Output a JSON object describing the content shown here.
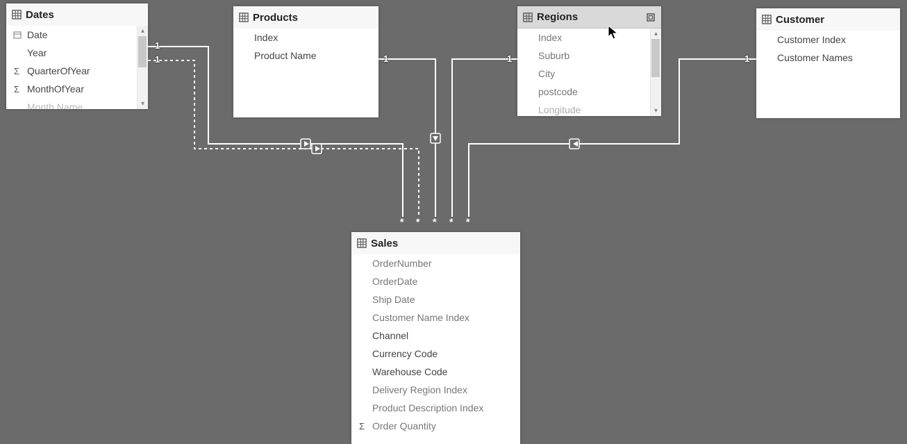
{
  "tables": {
    "dates": {
      "name": "Dates",
      "fields": [
        {
          "label": "Date",
          "sigma": false
        },
        {
          "label": "Year",
          "sigma": false
        },
        {
          "label": "QuarterOfYear",
          "sigma": true
        },
        {
          "label": "MonthOfYear",
          "sigma": true
        },
        {
          "label": "Month Name",
          "sigma": false
        }
      ]
    },
    "products": {
      "name": "Products",
      "fields": [
        {
          "label": "Index",
          "sigma": false
        },
        {
          "label": "Product Name",
          "sigma": false
        }
      ]
    },
    "regions": {
      "name": "Regions",
      "fields": [
        {
          "label": "Index",
          "sigma": false
        },
        {
          "label": "Suburb",
          "sigma": false
        },
        {
          "label": "City",
          "sigma": false
        },
        {
          "label": "postcode",
          "sigma": false
        },
        {
          "label": "Longitude",
          "sigma": false
        }
      ]
    },
    "customer": {
      "name": "Customer",
      "fields": [
        {
          "label": "Customer Index",
          "sigma": false
        },
        {
          "label": "Customer Names",
          "sigma": false
        }
      ]
    },
    "sales": {
      "name": "Sales",
      "fields": [
        {
          "label": "OrderNumber",
          "sigma": false,
          "dim": true
        },
        {
          "label": "OrderDate",
          "sigma": false,
          "dim": true
        },
        {
          "label": "Ship Date",
          "sigma": false,
          "dim": true
        },
        {
          "label": "Customer Name Index",
          "sigma": false,
          "dim": true
        },
        {
          "label": "Channel",
          "sigma": false,
          "dim": false
        },
        {
          "label": "Currency Code",
          "sigma": false,
          "dim": false
        },
        {
          "label": "Warehouse Code",
          "sigma": false,
          "dim": false
        },
        {
          "label": "Delivery Region Index",
          "sigma": false,
          "dim": true
        },
        {
          "label": "Product Description Index",
          "sigma": false,
          "dim": true
        },
        {
          "label": "Order Quantity",
          "sigma": true,
          "dim": true
        }
      ]
    }
  },
  "relationships": [
    {
      "from": "dates",
      "to": "sales",
      "from_card": "1",
      "to_card": "*",
      "active": true
    },
    {
      "from": "dates",
      "to": "sales",
      "from_card": "1",
      "to_card": "*",
      "active": false
    },
    {
      "from": "products",
      "to": "sales",
      "from_card": "1",
      "to_card": "*",
      "active": true
    },
    {
      "from": "regions",
      "to": "sales",
      "from_card": "1",
      "to_card": "*",
      "active": true
    },
    {
      "from": "customer",
      "to": "sales",
      "from_card": "1",
      "to_card": "*",
      "active": true
    }
  ],
  "labels": {
    "one": "1",
    "many": "*"
  }
}
